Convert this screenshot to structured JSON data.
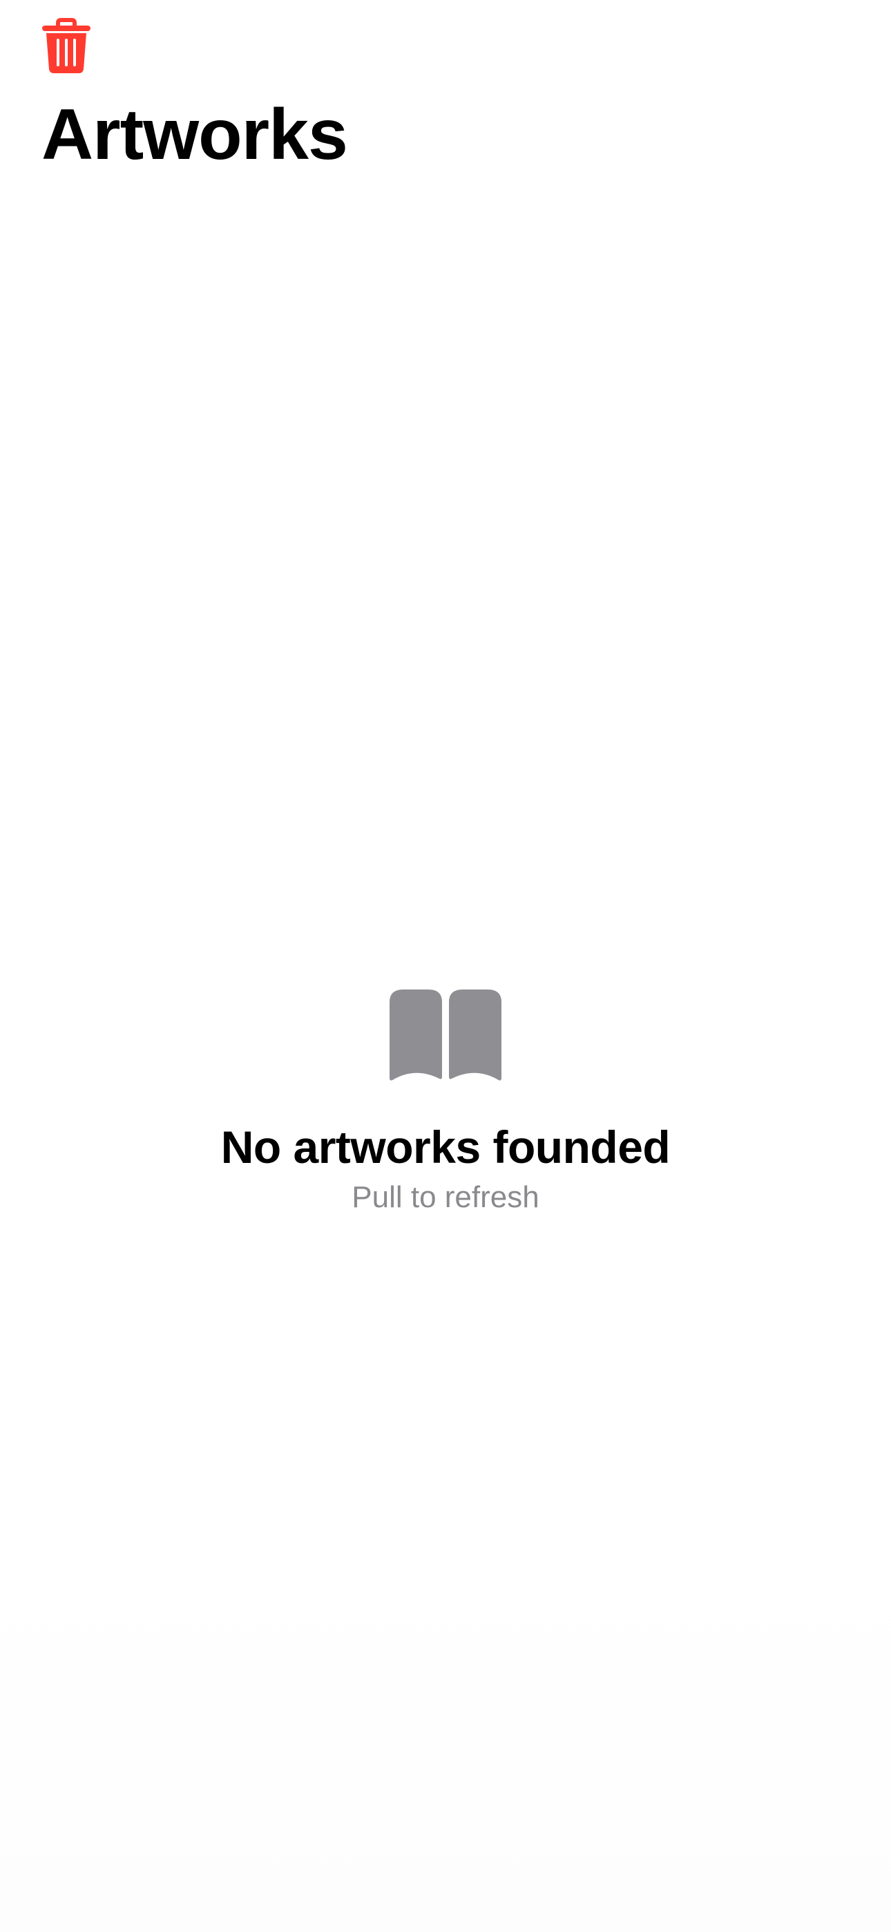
{
  "toolbar": {
    "trash_icon": "trash-icon",
    "trash_color": "#ff3b30"
  },
  "header": {
    "title": "Artworks"
  },
  "empty_state": {
    "icon": "book-icon",
    "icon_color": "#8e8e93",
    "title": "No artworks founded",
    "subtitle": "Pull to refresh"
  }
}
